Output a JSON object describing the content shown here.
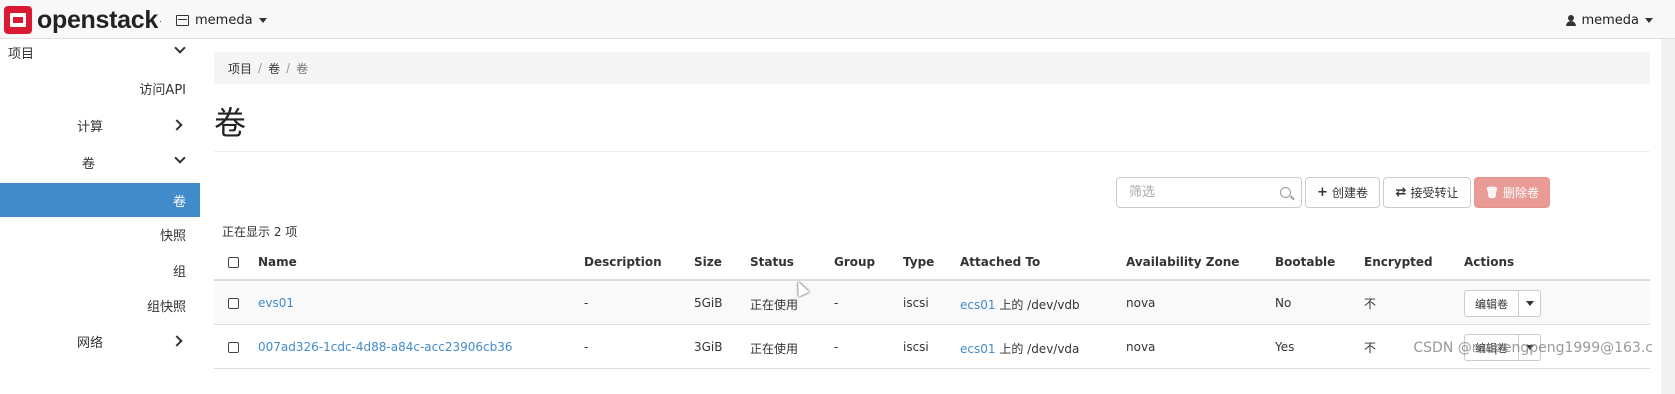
{
  "navbar": {
    "brand": "openstack",
    "brand_mark": ".",
    "project": "memeda",
    "user": "memeda"
  },
  "sidebar": {
    "items": [
      {
        "label": "项目",
        "expanded": true
      },
      {
        "label": "访问API"
      },
      {
        "label": "计算",
        "expanded": false
      },
      {
        "label": "卷",
        "expanded": true
      },
      {
        "label": "卷",
        "active": true
      },
      {
        "label": "快照"
      },
      {
        "label": "组"
      },
      {
        "label": "组快照"
      },
      {
        "label": "网络",
        "expanded": false
      }
    ]
  },
  "breadcrumb": [
    "项目",
    "卷",
    "卷"
  ],
  "breadcrumb_sep": "/",
  "page": {
    "title": "卷",
    "filter_placeholder": "筛选",
    "buttons": {
      "create": "创建卷",
      "create_icon": "+",
      "accept": "接受转让",
      "accept_icon": "⇄",
      "delete": "删除卷",
      "delete_icon": "🗑"
    },
    "count_text": "正在显示 2 项"
  },
  "table": {
    "columns": [
      "Name",
      "Description",
      "Size",
      "Status",
      "Group",
      "Type",
      "Attached To",
      "Availability Zone",
      "Bootable",
      "Encrypted",
      "Actions"
    ],
    "rows": [
      {
        "name": "evs01",
        "description": "-",
        "size": "5GiB",
        "status": "正在使用",
        "group": "-",
        "type": "iscsi",
        "attached_link": "ecs01",
        "attached_rest": " 上的 /dev/vdb",
        "zone": "nova",
        "bootable": "No",
        "encrypted": "不",
        "action": "编辑卷"
      },
      {
        "name": "007ad326-1cdc-4d88-a84c-acc23906cb36",
        "description": "-",
        "size": "3GiB",
        "status": "正在使用",
        "group": "-",
        "type": "iscsi",
        "attached_link": "ecs01",
        "attached_rest": " 上的 /dev/vda",
        "zone": "nova",
        "bootable": "Yes",
        "encrypted": "不",
        "action": "编辑卷"
      }
    ]
  },
  "watermark": "CSDN @mapengpeng1999@163.c",
  "colors": {
    "brand_red": "#da1a32",
    "active_blue": "#428bca",
    "link_blue": "#428bca",
    "delete_button": "#e99b95"
  }
}
